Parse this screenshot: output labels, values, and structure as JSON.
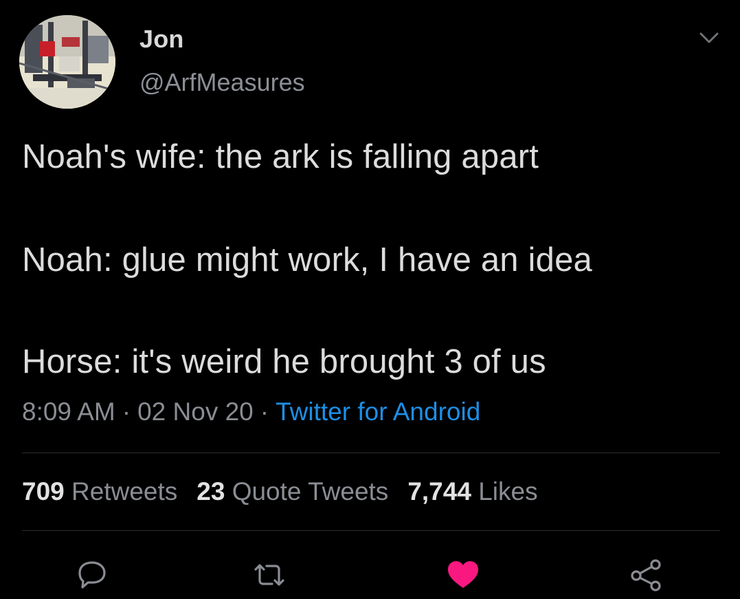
{
  "user": {
    "display_name": "Jon",
    "handle": "@ArfMeasures"
  },
  "tweet": {
    "lines": [
      "Noah's wife: the ark is falling apart",
      "Noah: glue might work, I have an idea",
      "Horse: it's weird he brought 3 of us"
    ],
    "time": "8:09 AM",
    "date": "02 Nov 20",
    "separator": "·",
    "source": "Twitter for Android"
  },
  "stats": {
    "retweets_count": "709",
    "retweets_label": "Retweets",
    "quotes_count": "23",
    "quotes_label": "Quote Tweets",
    "likes_count": "7,744",
    "likes_label": "Likes"
  },
  "actions": {
    "reply_icon": "reply-icon",
    "retweet_icon": "retweet-icon",
    "like_icon": "heart-icon",
    "share_icon": "share-icon",
    "like_state": "liked"
  },
  "colors": {
    "background": "#000000",
    "link": "#1d8fe6",
    "like": "#f91880",
    "muted": "#8a8d93"
  }
}
